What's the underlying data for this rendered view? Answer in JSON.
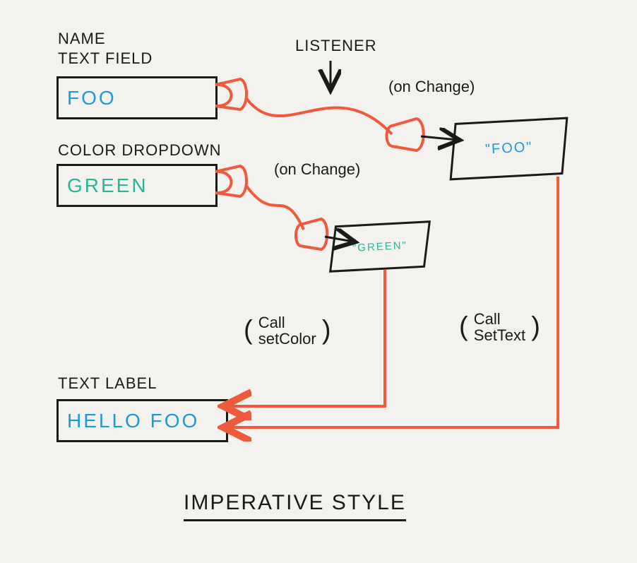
{
  "labels": {
    "name_label_l1": "NAME",
    "name_label_l2": "TEXT FIELD",
    "color_label": "COLOR DROPDOWN",
    "text_label": "TEXT LABEL",
    "listener_label": "LISTENER",
    "title": "IMPERATIVE STYLE"
  },
  "fields": {
    "name_value": "FOO",
    "color_value": "GREEN",
    "text_label_value": "HELLO FOO"
  },
  "listener_values": {
    "name_received": "\"FOO\"",
    "color_received": "\"GREEN\""
  },
  "annotations": {
    "on_change_name": "(on Change)",
    "on_change_color": "(on Change)",
    "call_set_color_l1": "Call",
    "call_set_color_l2": "setColor",
    "call_set_text_l1": "Call",
    "call_set_text_l2": "SetText"
  },
  "diagram": {
    "description": "Imperative-style UI data flow: a name text field and a color dropdown each emit onChange to a listener, which then calls setText / setColor on a text label.",
    "nodes": [
      {
        "id": "name_field",
        "kind": "text_field",
        "label": "NAME TEXT FIELD",
        "value": "FOO"
      },
      {
        "id": "color_field",
        "kind": "dropdown",
        "label": "COLOR DROPDOWN",
        "value": "GREEN"
      },
      {
        "id": "listener",
        "kind": "listener",
        "label": "LISTENER"
      },
      {
        "id": "text_label",
        "kind": "text_label",
        "label": "TEXT LABEL",
        "value": "HELLO FOO"
      }
    ],
    "edges": [
      {
        "from": "name_field",
        "to": "listener",
        "event": "onChange",
        "payload": "\"FOO\""
      },
      {
        "from": "color_field",
        "to": "listener",
        "event": "onChange",
        "payload": "\"GREEN\""
      },
      {
        "from": "listener",
        "to": "text_label",
        "call": "setText"
      },
      {
        "from": "listener",
        "to": "text_label",
        "call": "setColor"
      }
    ]
  }
}
